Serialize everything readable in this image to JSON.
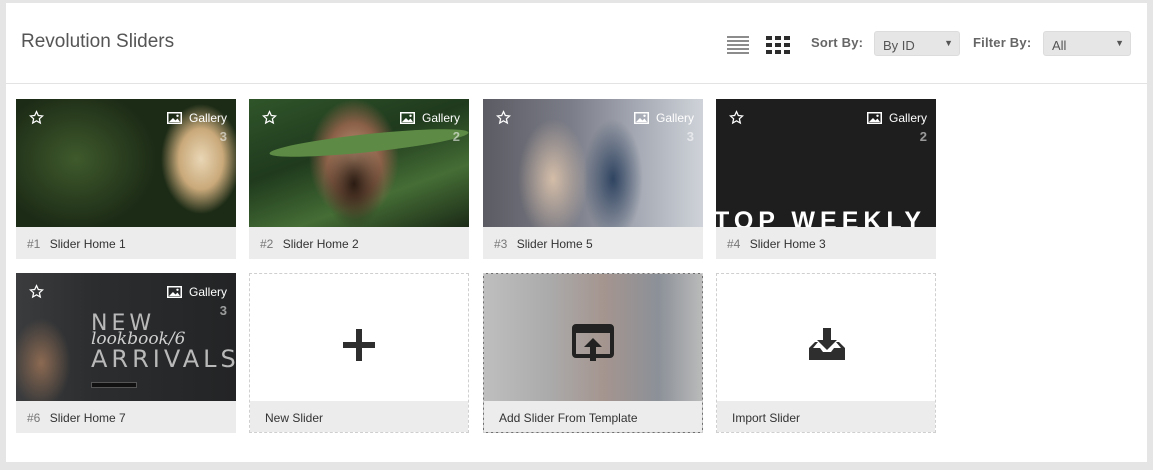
{
  "header": {
    "title": "Revolution Sliders",
    "sort_label": "Sort By:",
    "sort_value": "By ID",
    "filter_label": "Filter By:",
    "filter_value": "All"
  },
  "sliders": [
    {
      "id": "#1",
      "name": "Slider Home 1",
      "type": "Gallery",
      "count": "3"
    },
    {
      "id": "#2",
      "name": "Slider Home 2",
      "type": "Gallery",
      "count": "2"
    },
    {
      "id": "#3",
      "name": "Slider Home 5",
      "type": "Gallery",
      "count": "3"
    },
    {
      "id": "#4",
      "name": "Slider Home 3",
      "type": "Gallery",
      "count": "2",
      "thumb_text": "TOP WEEKLY"
    },
    {
      "id": "#6",
      "name": "Slider Home 7",
      "type": "Gallery",
      "count": "3",
      "thumb_text_1": "NEW",
      "thumb_text_2": "lookbook/6",
      "thumb_text_3": "ARRIVALS"
    }
  ],
  "actions": {
    "new_slider": "New Slider",
    "add_from_template": "Add Slider From Template",
    "import_slider": "Import Slider"
  }
}
